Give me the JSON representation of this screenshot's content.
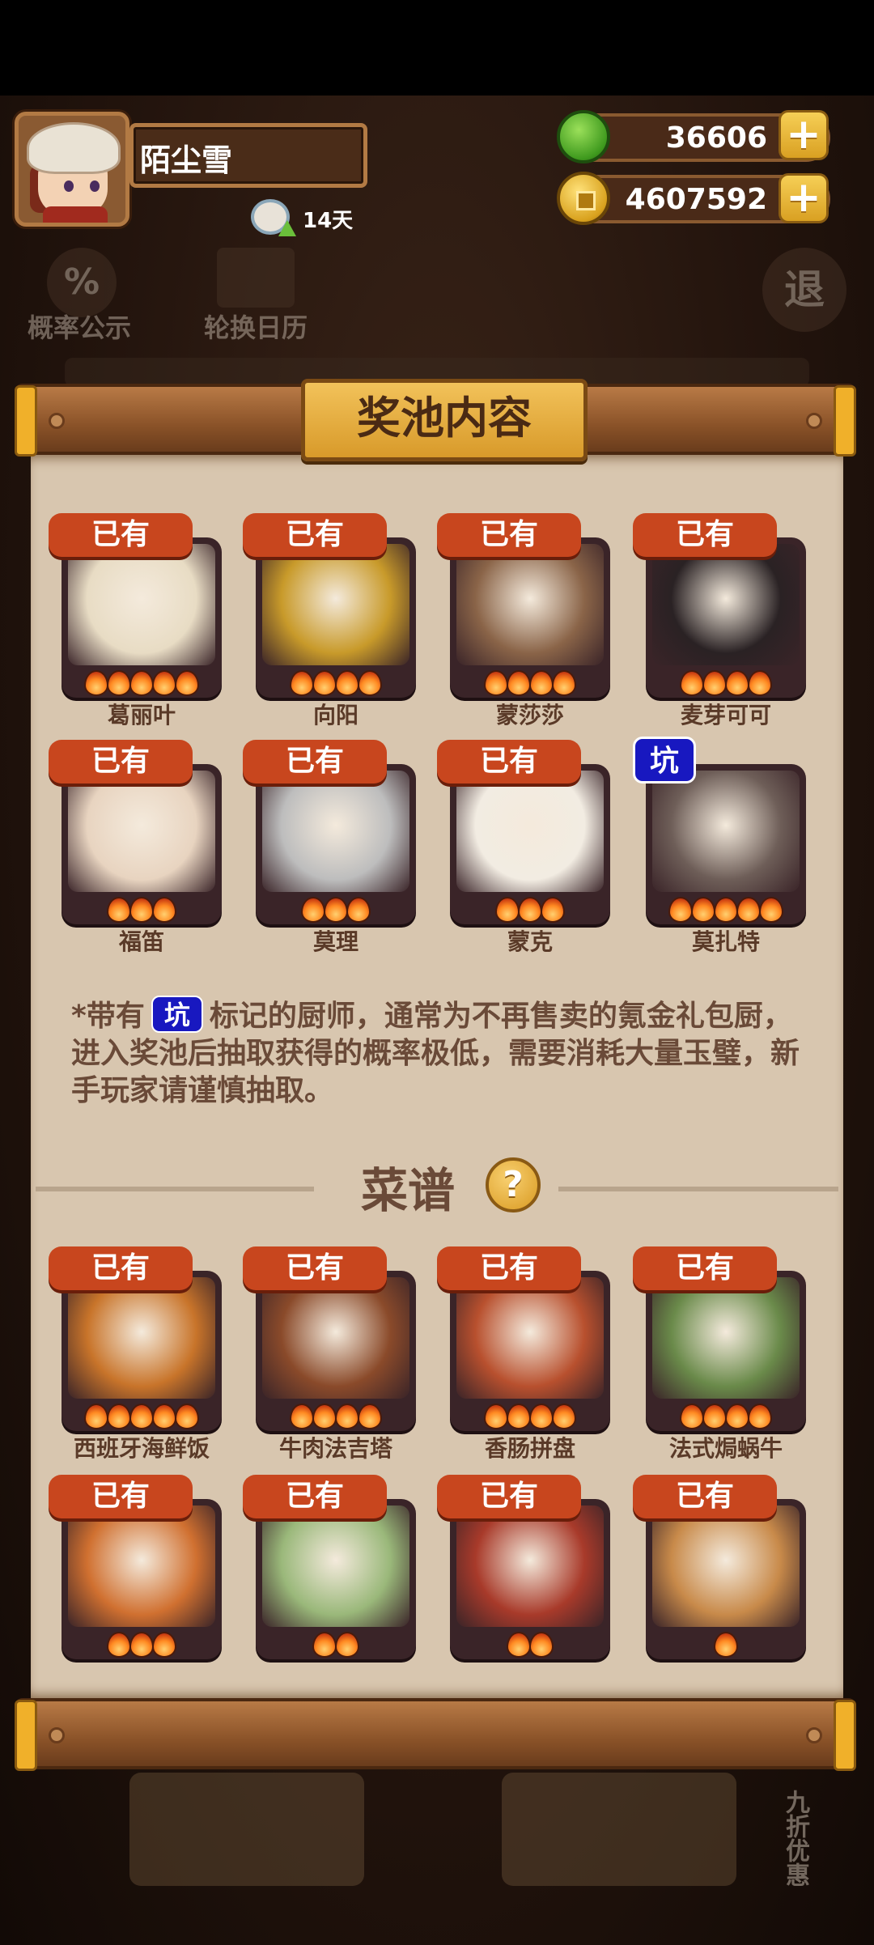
{
  "player": {
    "name": "陌尘雪",
    "vip_days": "14天"
  },
  "currency": {
    "jade": "36606",
    "coins": "4607592"
  },
  "background_ui": {
    "probability": "概率公示",
    "calendar": "轮换日历",
    "exit": "退",
    "side_sale": "九折优惠"
  },
  "panel": {
    "title": "奖池内容"
  },
  "tags": {
    "owned": "已有",
    "pit": "坑"
  },
  "chefs": [
    {
      "name": "葛丽叶",
      "tag": "已有",
      "stars": 5,
      "art": "#e8dcc4"
    },
    {
      "name": "向阳",
      "tag": "已有",
      "stars": 4,
      "art": "#c89a2a"
    },
    {
      "name": "蒙莎莎",
      "tag": "已有",
      "stars": 4,
      "art": "#8a6448"
    },
    {
      "name": "麦芽可可",
      "tag": "已有",
      "stars": 4,
      "art": "#2a2224"
    },
    {
      "name": "福笛",
      "tag": "已有",
      "stars": 3,
      "art": "#e8d4c0"
    },
    {
      "name": "莫理",
      "tag": "已有",
      "stars": 3,
      "art": "#bdbdbd"
    },
    {
      "name": "蒙克",
      "tag": "已有",
      "stars": 3,
      "art": "#f2ece2"
    },
    {
      "name": "莫扎特",
      "tag": "坑",
      "stars": 5,
      "art": "#6e5e58"
    }
  ],
  "note": {
    "prefix": "*带有",
    "pit": "坑",
    "text": "标记的厨师，通常为不再售卖的氪金礼包厨，进入奖池后抽取获得的概率极低，需要消耗大量玉璧，新手玩家请谨慎抽取。"
  },
  "recipes_section": {
    "title": "菜谱",
    "help": "?"
  },
  "recipes": [
    {
      "name": "西班牙海鲜饭",
      "tag": "已有",
      "stars": 5,
      "art": "#c8742a"
    },
    {
      "name": "牛肉法吉塔",
      "tag": "已有",
      "stars": 4,
      "art": "#8a4a2a"
    },
    {
      "name": "香肠拼盘",
      "tag": "已有",
      "stars": 4,
      "art": "#b8502e"
    },
    {
      "name": "法式焗蜗牛",
      "tag": "已有",
      "stars": 4,
      "art": "#6a8a4a"
    },
    {
      "name": "",
      "tag": "已有",
      "stars": 3,
      "art": "#d07030"
    },
    {
      "name": "",
      "tag": "已有",
      "stars": 2,
      "art": "#9ab87a"
    },
    {
      "name": "",
      "tag": "已有",
      "stars": 2,
      "art": "#a83a2a"
    },
    {
      "name": "",
      "tag": "已有",
      "stars": 1,
      "art": "#c88a4a"
    }
  ]
}
